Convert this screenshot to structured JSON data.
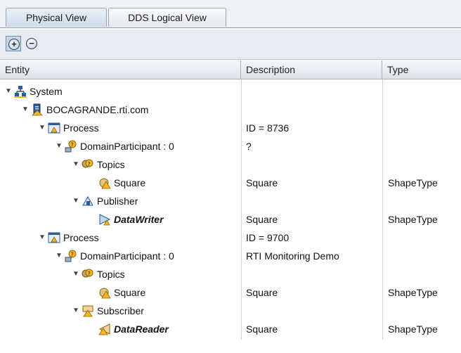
{
  "tabs": [
    {
      "label": "Physical View",
      "active": true
    },
    {
      "label": "DDS Logical View",
      "active": false
    }
  ],
  "toolbar": {
    "expand_icon": "plus-circle-icon",
    "collapse_icon": "minus-circle-icon"
  },
  "columns": {
    "entity": "Entity",
    "description": "Description",
    "type": "Type"
  },
  "colors": {
    "accent": "#2b5c9e",
    "warning": "#f5b91e",
    "selected_tab": "#cfdbea"
  },
  "tree": [
    {
      "entity": "System",
      "icon": "system-network-icon",
      "description": "",
      "type": "",
      "expanded": true
    },
    {
      "entity": "BOCAGRANDE.rti.com",
      "icon": "host-server-icon",
      "description": "",
      "type": "",
      "expanded": true
    },
    {
      "entity": "Process",
      "icon": "process-window-icon",
      "description": "ID = 8736",
      "type": "",
      "expanded": true
    },
    {
      "entity": "DomainParticipant : 0",
      "icon": "participant-warning-icon",
      "description": "?",
      "type": "",
      "expanded": true
    },
    {
      "entity": "Topics",
      "icon": "topics-warning-icon",
      "description": "",
      "type": "",
      "expanded": true
    },
    {
      "entity": "Square",
      "icon": "topic-warning-icon",
      "description": "Square",
      "type": "ShapeType",
      "expanded": null
    },
    {
      "entity": "Publisher",
      "icon": "publisher-icon",
      "description": "",
      "type": "",
      "expanded": true
    },
    {
      "entity": "DataWriter",
      "icon": "datawriter-icon",
      "description": "Square",
      "type": "ShapeType",
      "expanded": null
    },
    {
      "entity": "Process",
      "icon": "process-window-icon",
      "description": "ID = 9700",
      "type": "",
      "expanded": true
    },
    {
      "entity": "DomainParticipant : 0",
      "icon": "participant-warning-icon",
      "description": "RTI Monitoring Demo",
      "type": "",
      "expanded": true
    },
    {
      "entity": "Topics",
      "icon": "topics-warning-icon",
      "description": "",
      "type": "",
      "expanded": true
    },
    {
      "entity": "Square",
      "icon": "topic-warning-icon",
      "description": "Square",
      "type": "ShapeType",
      "expanded": null
    },
    {
      "entity": "Subscriber",
      "icon": "subscriber-warning-icon",
      "description": "",
      "type": "",
      "expanded": true
    },
    {
      "entity": "DataReader",
      "icon": "datareader-warning-icon",
      "description": "Square",
      "type": "ShapeType",
      "expanded": null
    }
  ]
}
